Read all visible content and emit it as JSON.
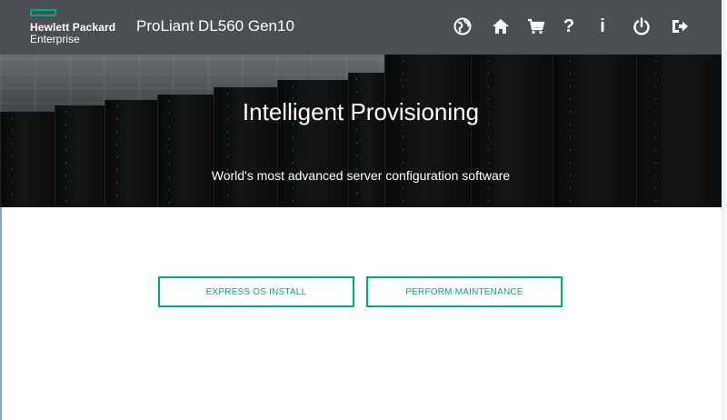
{
  "brand": {
    "logo_line1": "Hewlett Packard",
    "logo_line2": "Enterprise",
    "accent_color": "#01a982"
  },
  "header": {
    "product_title": "ProLiant DL560 Gen10",
    "icons": [
      {
        "name": "globe-icon",
        "glyph": "globe"
      },
      {
        "name": "home-icon",
        "glyph": "home"
      },
      {
        "name": "cart-icon",
        "glyph": "cart"
      },
      {
        "name": "help-icon",
        "glyph": "?"
      },
      {
        "name": "info-icon",
        "glyph": "i"
      },
      {
        "name": "power-icon",
        "glyph": "power"
      },
      {
        "name": "logout-icon",
        "glyph": "logout"
      }
    ]
  },
  "hero": {
    "title": "Intelligent Provisioning",
    "subtitle": "World's most advanced server configuration software"
  },
  "actions": {
    "express_os_install": "EXPRESS OS INSTALL",
    "perform_maintenance": "PERFORM MAINTENANCE"
  }
}
